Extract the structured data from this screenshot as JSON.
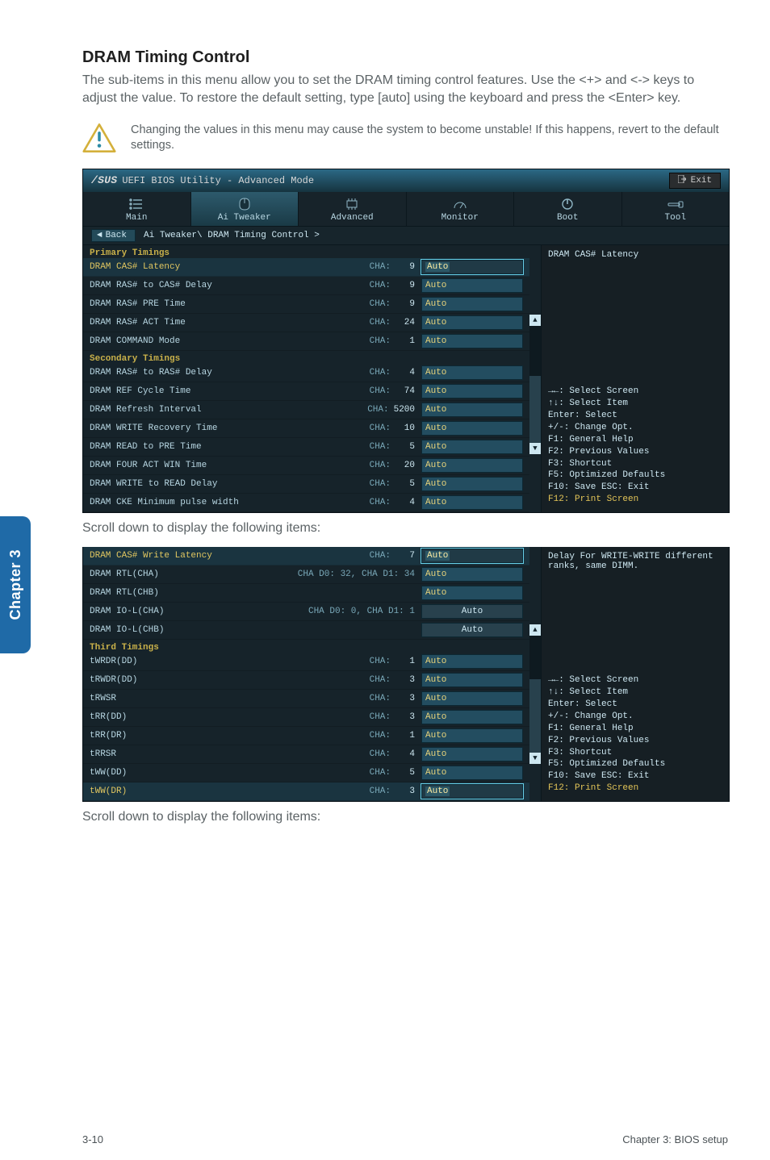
{
  "doc": {
    "title": "DRAM Timing Control",
    "intro": "The sub-items in this menu allow you to set the DRAM timing control features. Use the <+> and <-> keys to adjust the value. To restore the default setting, type [auto] using the keyboard and press the <Enter> key.",
    "warning": "Changing the values in this menu may cause the system to become unstable! If this happens, revert to the default settings.",
    "scroll_note": "Scroll down to display the following items:",
    "page_left": "3-10",
    "page_right": "Chapter 3: BIOS setup",
    "chapter_tab": "Chapter 3"
  },
  "bios1": {
    "title_logo": "/SUS",
    "title_rest": "UEFI BIOS Utility - Advanced Mode",
    "exit": "Exit",
    "tabs": {
      "main": "Main",
      "tweaker": "Ai Tweaker",
      "advanced": "Advanced",
      "monitor": "Monitor",
      "boot": "Boot",
      "tool": "Tool"
    },
    "crumb_back": "Back",
    "crumb_path": "Ai Tweaker\\ DRAM Timing Control >",
    "groups": {
      "primary": "Primary Timings",
      "secondary": "Secondary Timings"
    },
    "rows": [
      {
        "k": "cas",
        "name": "DRAM CAS# Latency",
        "cha": "CHA:",
        "val": "9",
        "field": "Auto",
        "sel": true
      },
      {
        "k": "ras2cas",
        "name": "DRAM RAS# to CAS# Delay",
        "cha": "CHA:",
        "val": "9",
        "field": "Auto"
      },
      {
        "k": "raspre",
        "name": "DRAM RAS# PRE Time",
        "cha": "CHA:",
        "val": "9",
        "field": "Auto"
      },
      {
        "k": "rasact",
        "name": "DRAM RAS# ACT Time",
        "cha": "CHA:",
        "val": "24",
        "field": "Auto"
      },
      {
        "k": "cmd",
        "name": "DRAM COMMAND Mode",
        "cha": "CHA:",
        "val": "1",
        "field": "Auto"
      },
      {
        "k": "ras2ras",
        "name": "DRAM RAS# to RAS# Delay",
        "cha": "CHA:",
        "val": "4",
        "field": "Auto"
      },
      {
        "k": "ref",
        "name": "DRAM REF Cycle Time",
        "cha": "CHA:",
        "val": "74",
        "field": "Auto"
      },
      {
        "k": "refi",
        "name": "DRAM Refresh Interval",
        "cha": "CHA:",
        "val": "5200",
        "field": "Auto"
      },
      {
        "k": "wrrec",
        "name": "DRAM WRITE Recovery Time",
        "cha": "CHA:",
        "val": "10",
        "field": "Auto"
      },
      {
        "k": "rd2pre",
        "name": "DRAM READ to PRE Time",
        "cha": "CHA:",
        "val": "5",
        "field": "Auto"
      },
      {
        "k": "faw",
        "name": "DRAM FOUR ACT WIN Time",
        "cha": "CHA:",
        "val": "20",
        "field": "Auto"
      },
      {
        "k": "wr2rd",
        "name": "DRAM WRITE to READ Delay",
        "cha": "CHA:",
        "val": "5",
        "field": "Auto"
      },
      {
        "k": "cke",
        "name": "DRAM CKE Minimum pulse width",
        "cha": "CHA:",
        "val": "4",
        "field": "Auto"
      }
    ],
    "info_title": "DRAM CAS# Latency",
    "help": [
      "→←: Select Screen",
      "↑↓: Select Item",
      "Enter: Select",
      "+/-: Change Opt.",
      "F1: General Help",
      "F2: Previous Values",
      "F3: Shortcut",
      "F5: Optimized Defaults",
      "F10: Save   ESC: Exit",
      "F12: Print Screen"
    ]
  },
  "bios2": {
    "groups": {
      "third": "Third Timings"
    },
    "rows": [
      {
        "k": "caswl",
        "name": "DRAM CAS# Write Latency",
        "cha": "CHA:",
        "val": "7",
        "field": "Auto",
        "sel": true
      },
      {
        "k": "rtlcha",
        "name": "DRAM RTL(CHA)",
        "sub": "CHA D0: 32, CHA D1: 34",
        "field": "Auto"
      },
      {
        "k": "rtlchb",
        "name": "DRAM RTL(CHB)",
        "field": "Auto"
      },
      {
        "k": "iolcha",
        "name": "DRAM IO-L(CHA)",
        "sub": "CHA D0:  0, CHA D1:  1",
        "field": "Auto",
        "plain": true
      },
      {
        "k": "iolchb",
        "name": "DRAM IO-L(CHB)",
        "field": "Auto",
        "plain": true
      },
      {
        "k": "twrdrdd",
        "name": "tWRDR(DD)",
        "cha": "CHA:",
        "val": "1",
        "field": "Auto"
      },
      {
        "k": "trwdrdd",
        "name": "tRWDR(DD)",
        "cha": "CHA:",
        "val": "3",
        "field": "Auto"
      },
      {
        "k": "trwsr",
        "name": "tRWSR",
        "cha": "CHA:",
        "val": "3",
        "field": "Auto"
      },
      {
        "k": "trrdd",
        "name": "tRR(DD)",
        "cha": "CHA:",
        "val": "3",
        "field": "Auto"
      },
      {
        "k": "trrdr",
        "name": "tRR(DR)",
        "cha": "CHA:",
        "val": "1",
        "field": "Auto"
      },
      {
        "k": "trrsr",
        "name": "tRRSR",
        "cha": "CHA:",
        "val": "4",
        "field": "Auto"
      },
      {
        "k": "twwdd",
        "name": "tWW(DD)",
        "cha": "CHA:",
        "val": "5",
        "field": "Auto"
      },
      {
        "k": "twwdr",
        "name": "tWW(DR)",
        "cha": "CHA:",
        "val": "3",
        "field": "Auto",
        "sel": true
      }
    ],
    "info_title": "Delay For WRITE-WRITE different ranks, same DIMM.",
    "help": [
      "→←: Select Screen",
      "↑↓: Select Item",
      "Enter: Select",
      "+/-: Change Opt.",
      "F1: General Help",
      "F2: Previous Values",
      "F3: Shortcut",
      "F5: Optimized Defaults",
      "F10: Save   ESC: Exit",
      "F12: Print Screen"
    ]
  }
}
